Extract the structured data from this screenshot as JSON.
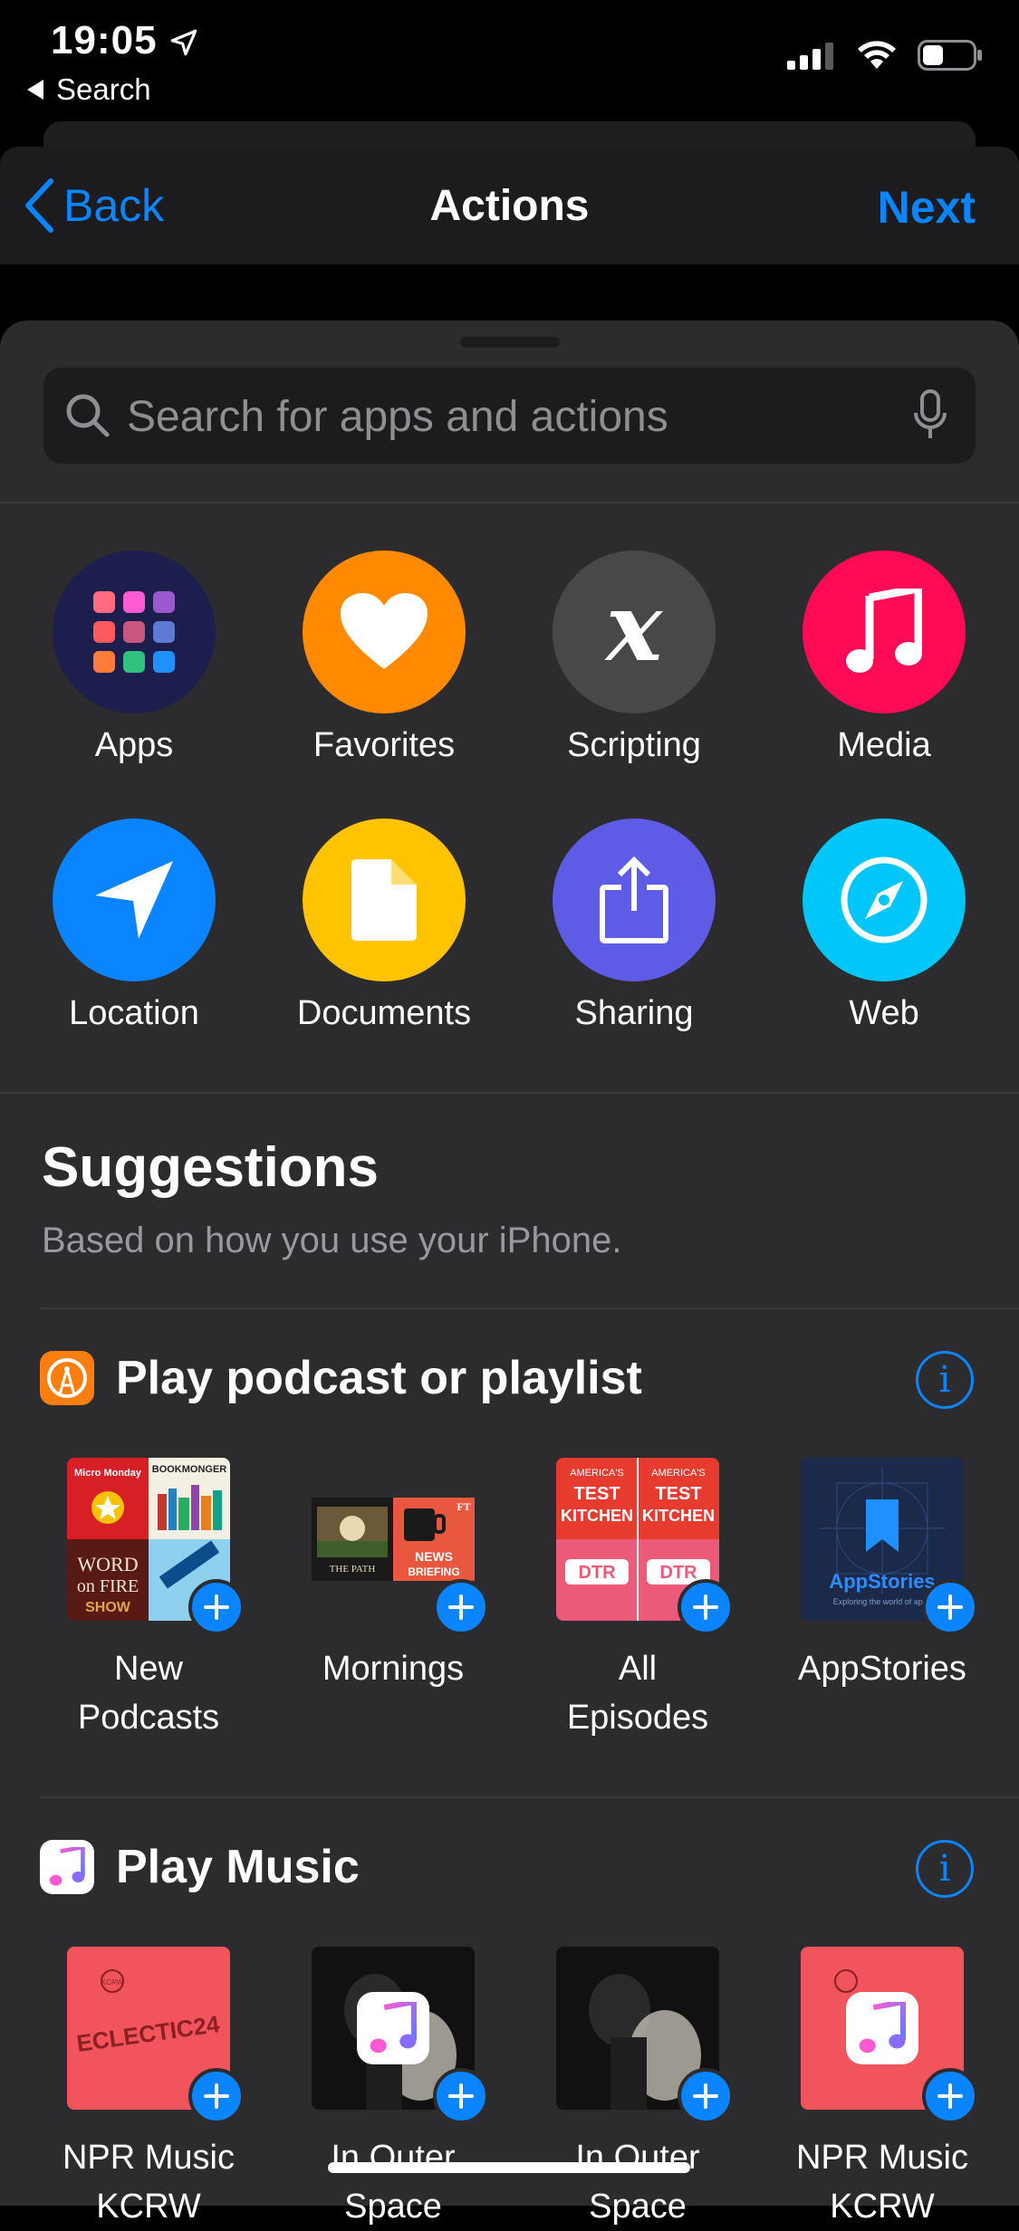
{
  "status_bar": {
    "time": "19:05",
    "back_app": "Search"
  },
  "nav": {
    "back_label": "Back",
    "title": "Actions",
    "next_label": "Next"
  },
  "search": {
    "placeholder": "Search for apps and actions"
  },
  "categories": [
    {
      "label": "Apps",
      "icon": "apps-grid-icon",
      "color": "#1c1f4d"
    },
    {
      "label": "Favorites",
      "icon": "heart-icon",
      "color": "#ff8a00"
    },
    {
      "label": "Scripting",
      "icon": "variable-x-icon",
      "color": "#48484a"
    },
    {
      "label": "Media",
      "icon": "music-note-icon",
      "color": "#ff0a54"
    },
    {
      "label": "Location",
      "icon": "location-arrow-icon",
      "color": "#0a84ff"
    },
    {
      "label": "Documents",
      "icon": "document-icon",
      "color": "#ffc300"
    },
    {
      "label": "Sharing",
      "icon": "share-icon",
      "color": "#5e5ce6"
    },
    {
      "label": "Web",
      "icon": "compass-icon",
      "color": "#00c7f7"
    }
  ],
  "suggestions": {
    "title": "Suggestions",
    "subtitle": "Based on how you use your iPhone."
  },
  "podcast_section": {
    "title": "Play podcast or playlist",
    "app_icon": "overcast-icon",
    "items": [
      {
        "name_line1": "New",
        "name_line2": "Podcasts"
      },
      {
        "name_line1": "Mornings",
        "name_line2": ""
      },
      {
        "name_line1": "All",
        "name_line2": "Episodes"
      },
      {
        "name_line1": "AppStories",
        "name_line2": ""
      }
    ],
    "art_text": {
      "micro_monday": "Micro Monday",
      "bookmonger": "BOOKMONGER",
      "word_on_fire": "WORD on FIRE SHOW",
      "news_briefing": "NEWS BRIEFING",
      "the_path": "THE PATH",
      "ft": "FT",
      "test_kitchen": "AMERICA'S TEST KITCHEN",
      "dtr": "DTR",
      "appstories": "AppStories",
      "appstories_sub": "Exploring the world of apps"
    }
  },
  "music_section": {
    "title": "Play Music",
    "app_icon": "music-app-icon",
    "items": [
      {
        "name_line1": "NPR Music",
        "name_line2": "KCRW"
      },
      {
        "name_line1": "In Outer",
        "name_line2": "Space"
      },
      {
        "name_line1": "In Outer",
        "name_line2": "Space"
      },
      {
        "name_line1": "NPR Music",
        "name_line2": "KCRW"
      }
    ],
    "art_text": {
      "eclectic": "ECLECTIC24",
      "kcrw": "KCRW"
    }
  }
}
